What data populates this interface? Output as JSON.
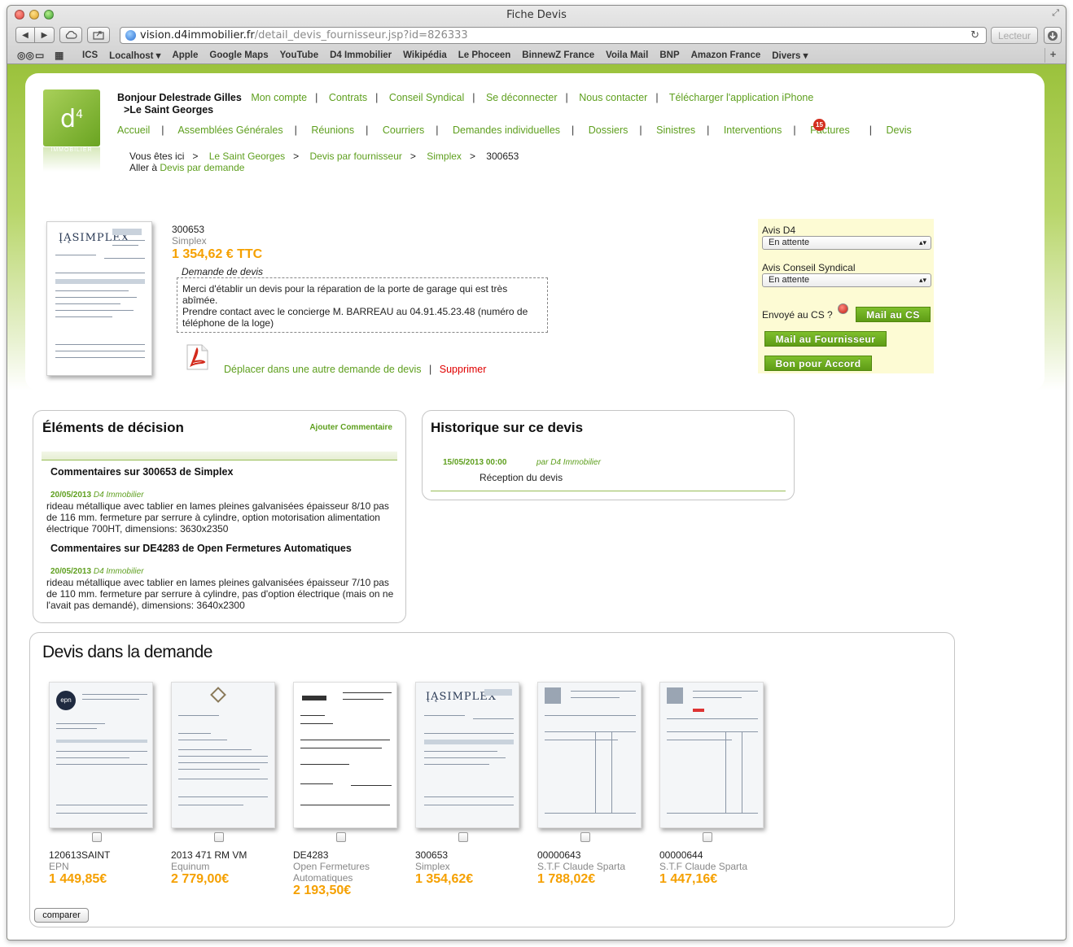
{
  "browser": {
    "title": "Fiche Devis",
    "url_host": "vision.d4immobilier.fr",
    "url_path": "/detail_devis_fournisseur.jsp?id=826333",
    "reader_label": "Lecteur",
    "bookmarks": [
      "ICS",
      "Localhost ▾",
      "Apple",
      "Google Maps",
      "YouTube",
      "D4 Immobilier",
      "Wikipédia",
      "Le Phoceen",
      "BinnewZ France",
      "Voila Mail",
      "BNP",
      "Amazon France",
      "Divers ▾"
    ]
  },
  "header": {
    "logo_text": "d",
    "logo_sup": "4",
    "logo_sub": "IMMOBILIER",
    "greeting": "Bonjour Delestrade Gilles",
    "site": ">Le Saint Georges",
    "top_links": [
      "Mon compte",
      "Contrats",
      "Conseil Syndical",
      "Se déconnecter",
      "Nous contacter",
      "Télécharger l'application iPhone"
    ],
    "nav": [
      "Accueil",
      "Assemblées Générales",
      "Réunions",
      "Courriers",
      "Demandes individuelles",
      "Dossiers",
      "Sinistres",
      "Interventions",
      "Factures",
      "Devis"
    ],
    "factures_badge": "15",
    "breadcrumb": {
      "prefix": "Vous êtes ici",
      "items": [
        "Le Saint Georges",
        "Devis par fournisseur",
        "Simplex"
      ],
      "current": "300653",
      "goto_prefix": "Aller à",
      "goto_link": "Devis par demande"
    }
  },
  "quote": {
    "ref": "300653",
    "supplier": "Simplex",
    "price": "1 354,62 € TTC",
    "request_label": "Demande de devis",
    "request_line1": "Merci d'établir un devis pour la réparation de la porte de garage qui est très abîmée.",
    "request_line2": "Prendre contact avec le concierge M. BARREAU au 04.91.45.23.48 (numéro de téléphone de la loge)",
    "move_link": "Déplacer dans une autre demande de devis",
    "delete_link": "Supprimer"
  },
  "sidebar": {
    "avis_d4_label": "Avis D4",
    "avis_d4_value": "En attente",
    "avis_cs_label": "Avis Conseil Syndical",
    "avis_cs_value": "En attente",
    "sent_label": "Envoyé au CS ?",
    "mail_cs": "Mail au CS",
    "mail_fournisseur": "Mail au Fournisseur",
    "bon_accord": "Bon pour Accord"
  },
  "decision": {
    "title": "Éléments de décision",
    "add_comment": "Ajouter Commentaire",
    "comments": [
      {
        "title": "Commentaires sur 300653 de Simplex",
        "date": "20/05/2013",
        "author": "D4 Immobilier",
        "text": "rideau métallique avec tablier en lames pleines galvanisées épaisseur 8/10 pas de 116 mm. fermeture par serrure à cylindre, option motorisation alimentation électrique 700HT, dimensions: 3630x2350"
      },
      {
        "title": "Commentaires sur DE4283 de Open Fermetures Automatiques",
        "date": "20/05/2013",
        "author": "D4 Immobilier",
        "text": "rideau métallique avec tablier en lames pleines galvanisées épaisseur 7/10 pas de 110 mm. fermeture par serrure à cylindre, pas d'option électrique (mais on ne l'avait pas demandé), dimensions: 3640x2300"
      }
    ]
  },
  "history": {
    "title": "Historique sur ce devis",
    "date": "15/05/2013 00:00",
    "by": "par D4 Immobilier",
    "text": "Réception du devis"
  },
  "devis_list": {
    "title": "Devis dans la demande",
    "compare_label": "comparer",
    "items": [
      {
        "ref": "120613SAINT",
        "supplier": "EPN",
        "price": "1 449,85€"
      },
      {
        "ref": "2013 471 RM VM",
        "supplier": "Equinum",
        "price": "2 779,00€"
      },
      {
        "ref": "DE4283",
        "supplier": "Open Fermetures Automatiques",
        "price": "2 193,50€"
      },
      {
        "ref": "300653",
        "supplier": "Simplex",
        "price": "1 354,62€"
      },
      {
        "ref": "00000643",
        "supplier": "S.T.F Claude Sparta",
        "price": "1 788,02€"
      },
      {
        "ref": "00000644",
        "supplier": "S.T.F Claude Sparta",
        "price": "1 447,16€"
      }
    ]
  },
  "colors": {
    "brand_green": "#5e9f1e",
    "price_orange": "#f5a000",
    "delete_red": "#e00000",
    "sidebar_bg": "#fdfbd4"
  }
}
